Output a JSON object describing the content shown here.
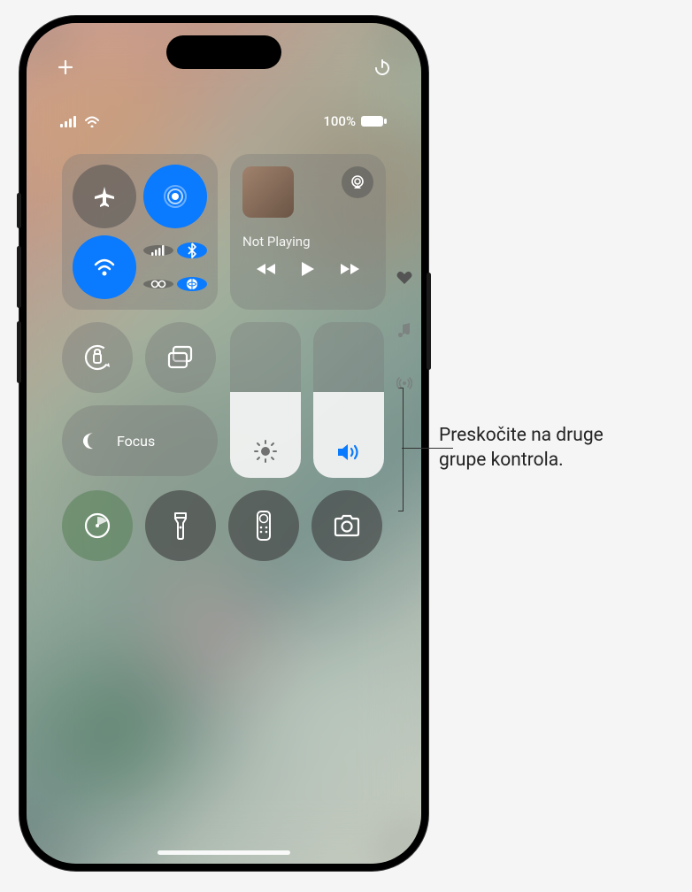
{
  "top": {
    "add_icon": "plus",
    "power_icon": "power"
  },
  "status": {
    "battery_pct": "100%"
  },
  "connectivity": {
    "airplane": {
      "state": "off"
    },
    "airdrop": {
      "state": "on"
    },
    "wifi": {
      "state": "on"
    },
    "cellular": {
      "state": "on"
    },
    "bluetooth": {
      "state": "on"
    },
    "hotspot": {
      "state": "on"
    }
  },
  "music": {
    "label": "Not Playing"
  },
  "focus": {
    "label": "Focus"
  },
  "sliders": {
    "brightness_pct": 55,
    "volume_pct": 55
  },
  "shortcuts": {
    "orientation_lock": "rotation-lock",
    "screen_mirroring": "rectangles",
    "timer": "timer",
    "flashlight": "flashlight",
    "remote": "remote",
    "camera": "camera"
  },
  "pages": {
    "icons": [
      "heart",
      "music-note",
      "antenna"
    ],
    "active": 0
  },
  "callout": {
    "line1": "Preskočite na druge",
    "line2": "grupe kontrola."
  }
}
